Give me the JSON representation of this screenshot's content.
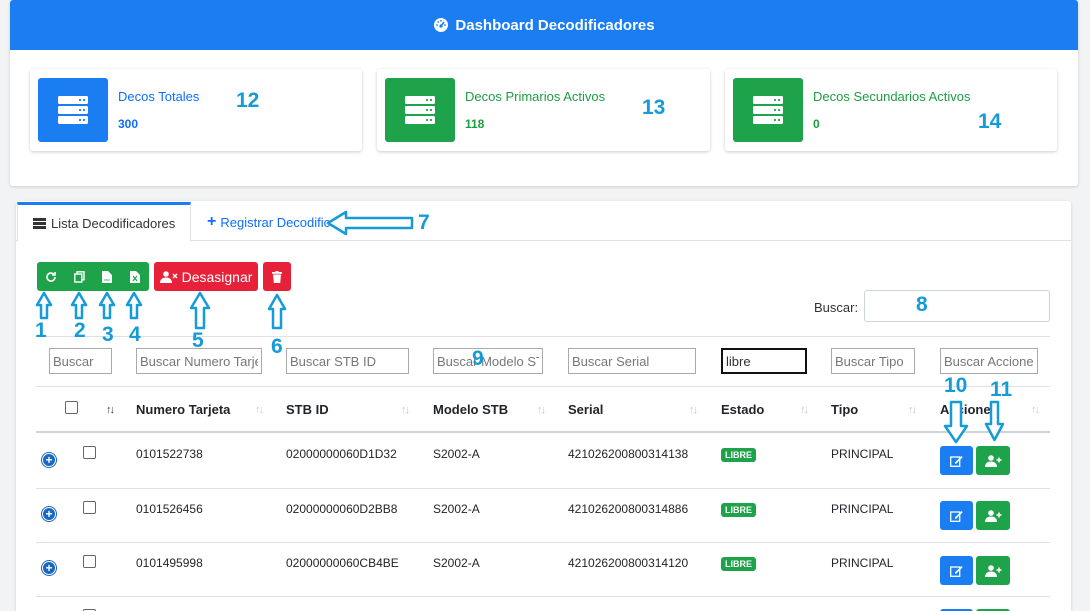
{
  "header": {
    "title": "Dashboard Decodificadores"
  },
  "stats": [
    {
      "title": "Decos Totales",
      "value": "300",
      "annotation": "12"
    },
    {
      "title": "Decos Primarios Activos",
      "value": "118",
      "annotation": "13"
    },
    {
      "title": "Decos Secundarios Activos",
      "value": "0",
      "annotation": "14"
    }
  ],
  "tabs": {
    "list": "Lista Decodificadores",
    "register": "Registrar Decodificador"
  },
  "toolbar": {
    "unassign": "Desasignar"
  },
  "search": {
    "label": "Buscar:",
    "value": ""
  },
  "filters": {
    "col0": "Buscar",
    "col1": "Buscar Numero Tarjeta",
    "col2": "Buscar STB ID",
    "col3": "Buscar Modelo STB",
    "col4": "Buscar Serial",
    "col5_value": "libre",
    "col6": "Buscar Tipo",
    "col7": "Buscar Acciones"
  },
  "columns": [
    "Numero Tarjeta",
    "STB ID",
    "Modelo STB",
    "Serial",
    "Estado",
    "Tipo",
    "Acciones"
  ],
  "rows": [
    {
      "card": "0101522738",
      "stb": "02000000060D1D32",
      "model": "S2002-A",
      "serial": "421026200800314138",
      "status": "LIBRE",
      "type": "PRINCIPAL"
    },
    {
      "card": "0101526456",
      "stb": "02000000060D2BB8",
      "model": "S2002-A",
      "serial": "421026200800314886",
      "status": "LIBRE",
      "type": "PRINCIPAL"
    },
    {
      "card": "0101495998",
      "stb": "02000000060CB4BE",
      "model": "S2002-A",
      "serial": "421026200800314120",
      "status": "LIBRE",
      "type": "PRINCIPAL"
    }
  ],
  "annotations": {
    "a1": "1",
    "a2": "2",
    "a3": "3",
    "a4": "4",
    "a5": "5",
    "a6": "6",
    "a7": "7",
    "a8": "8",
    "a9": "9",
    "a10": "10",
    "a11": "11"
  },
  "colors": {
    "primary": "#1a7ef2",
    "success": "#1ea34a",
    "danger": "#e8213a",
    "annotation": "#149bd8"
  }
}
